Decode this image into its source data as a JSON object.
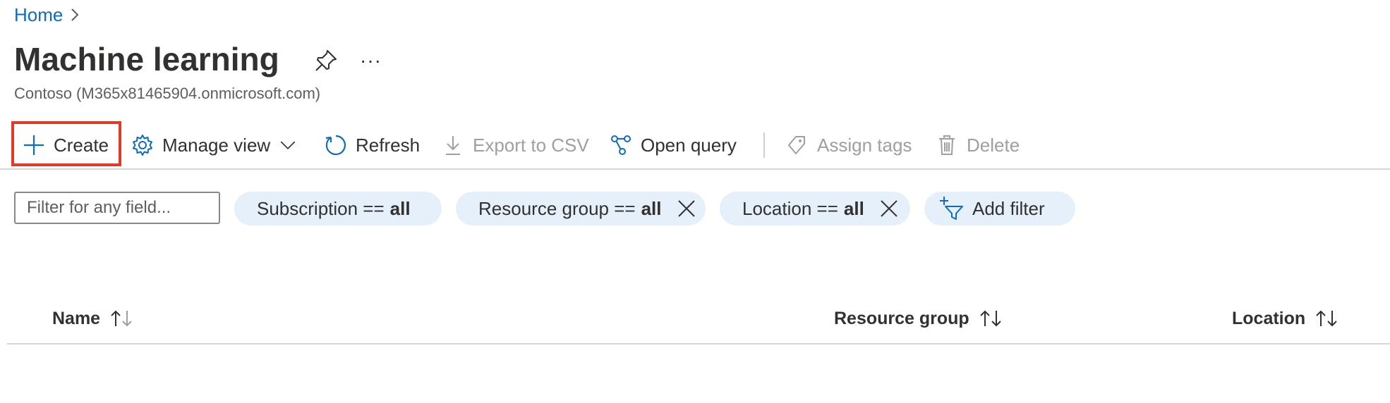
{
  "breadcrumb": {
    "home": "Home"
  },
  "page": {
    "title": "Machine learning",
    "subtitle": "Contoso (M365x81465904.onmicrosoft.com)",
    "more": "···"
  },
  "toolbar": {
    "create": "Create",
    "manage_view": "Manage view",
    "refresh": "Refresh",
    "export_csv": "Export to CSV",
    "open_query": "Open query",
    "assign_tags": "Assign tags",
    "delete": "Delete"
  },
  "filters": {
    "input_placeholder": "Filter for any field...",
    "pills": [
      {
        "label": "Subscription ==",
        "value": "all"
      },
      {
        "label": "Resource group ==",
        "value": "all"
      },
      {
        "label": "Location ==",
        "value": "all"
      }
    ],
    "add_filter": "Add filter"
  },
  "table": {
    "columns": [
      "Name",
      "Resource group",
      "Location"
    ]
  },
  "colors": {
    "link": "#0f6cbd",
    "highlight": "#e23a27",
    "pill_bg": "#e5f0fb",
    "disabled": "#a19f9d"
  }
}
